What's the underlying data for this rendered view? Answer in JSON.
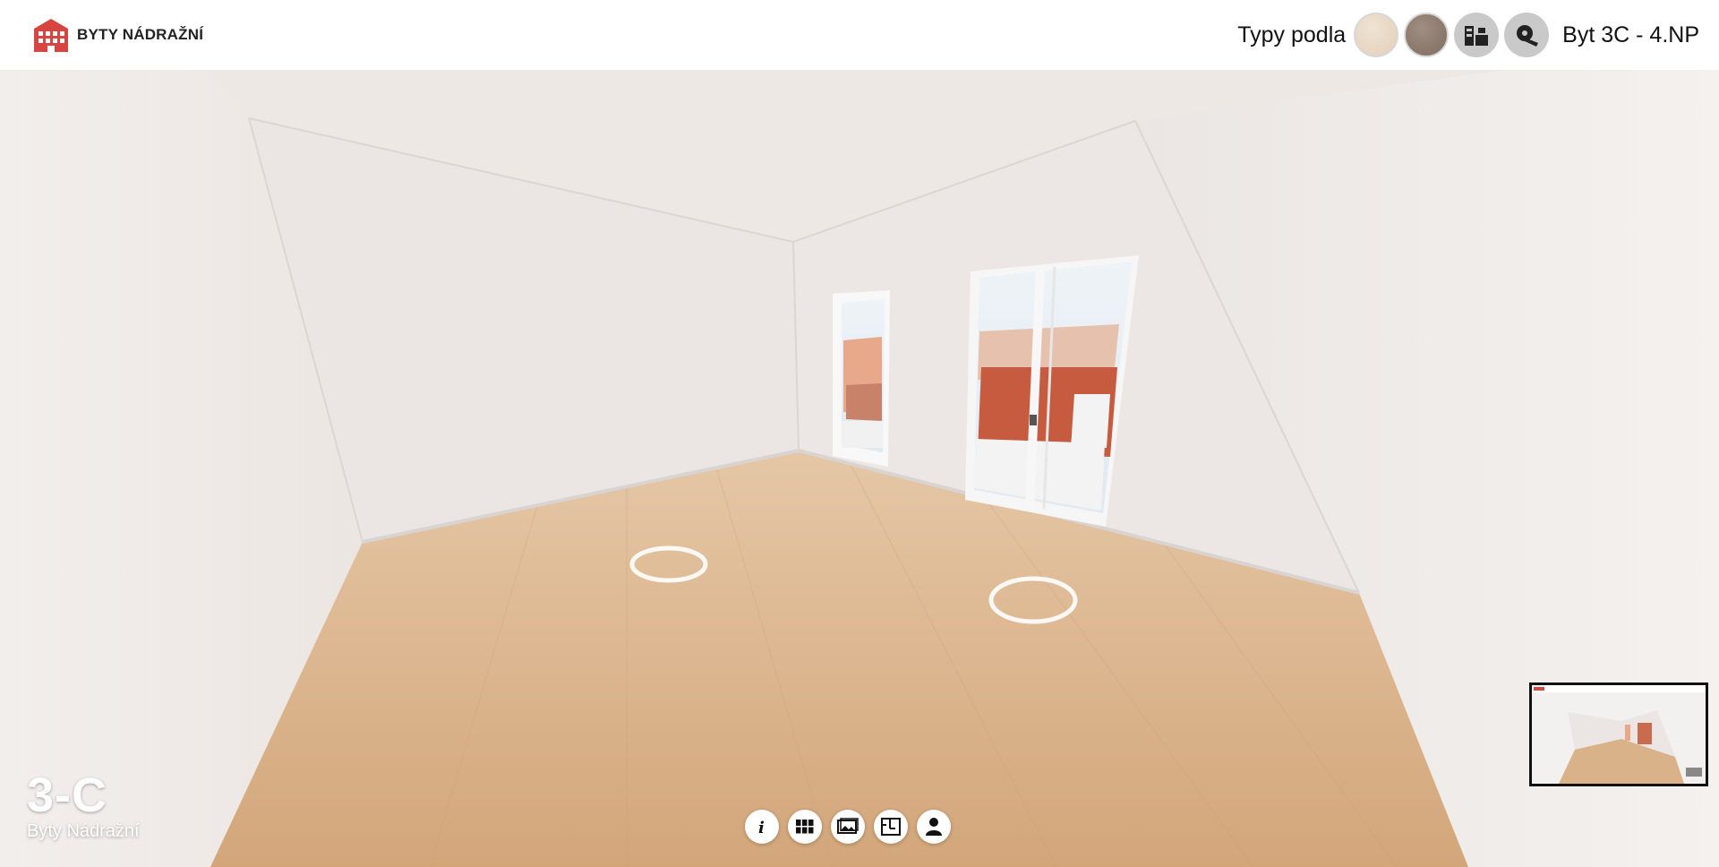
{
  "header": {
    "logo_text": "BYTY NÁDRAŽNÍ",
    "types_label": "Typy podla",
    "unit_title": "Byt 3C - 4.NP"
  },
  "swatches": [
    {
      "name": "light-wood",
      "color": "#e6d6c2"
    },
    {
      "name": "dark-wood",
      "color": "#8d7a6e"
    }
  ],
  "icons": {
    "furniture": "furniture-icon",
    "measure": "measure-tape-icon"
  },
  "overlay": {
    "unit_code": "3-C",
    "project_name": "Byty Nádražní"
  },
  "toolbar": [
    {
      "name": "info-icon"
    },
    {
      "name": "grid-icon"
    },
    {
      "name": "gallery-icon"
    },
    {
      "name": "floorplan-icon"
    },
    {
      "name": "contact-icon"
    }
  ],
  "colors": {
    "brand": "#d6453f",
    "floor": "#d9b28a"
  }
}
